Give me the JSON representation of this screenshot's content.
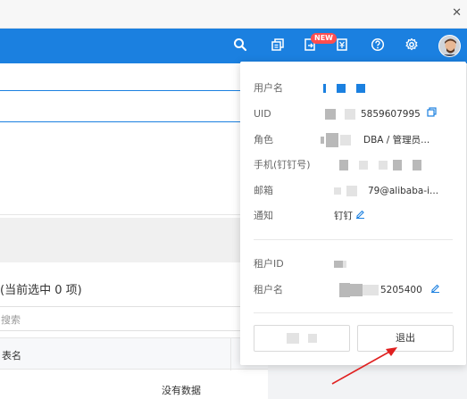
{
  "navbar": {
    "color": "#1b80e0",
    "icons": [
      "search-icon",
      "copy-icon",
      "export-icon",
      "bill-icon",
      "help-icon",
      "gear-icon"
    ],
    "new_badge": "NEW"
  },
  "background": {
    "selected_text": "(当前选中 0 项)",
    "search_placeholder": "搜索",
    "table_header": "表名",
    "empty_text": "没有数据"
  },
  "dropdown": {
    "username": {
      "label": "用户名"
    },
    "uid": {
      "label": "UID",
      "value": "5859607995"
    },
    "role": {
      "label": "角色",
      "value": "DBA / 管理员..."
    },
    "phone": {
      "label": "手机(钉钉号)"
    },
    "email": {
      "label": "邮箱",
      "value": "79@alibaba-i..."
    },
    "notify": {
      "label": "通知",
      "value": "钉钉"
    },
    "tenant_id": {
      "label": "租户ID"
    },
    "tenant_name": {
      "label": "租户名",
      "value": "5205400"
    },
    "logout_label": "退出"
  },
  "accent_color": "#1b80e0",
  "annotation_color": "#e02020"
}
